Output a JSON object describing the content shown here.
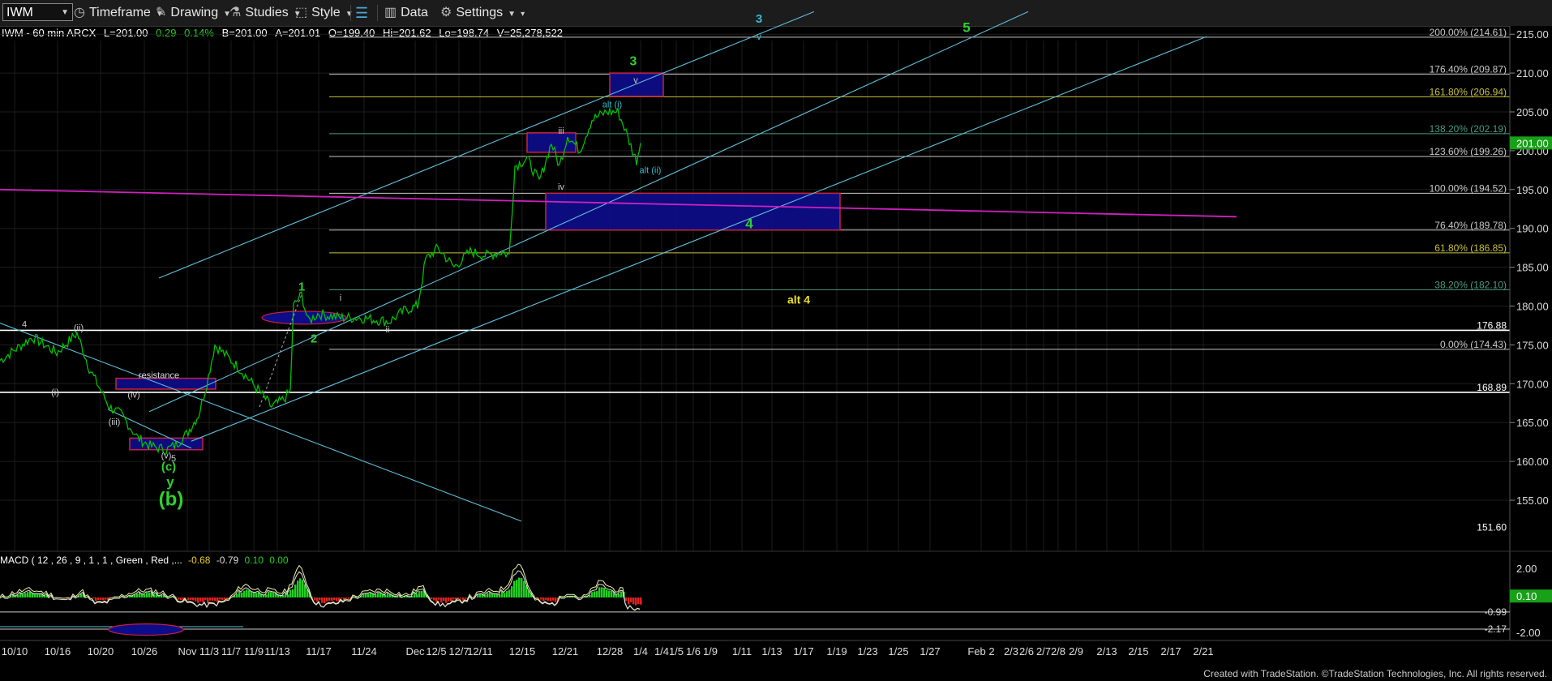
{
  "toolbar": {
    "symbol": "IWM",
    "timeframe": "Timeframe",
    "drawing": "Drawing",
    "studies": "Studies",
    "style": "Style",
    "data": "Data",
    "settings": "Settings"
  },
  "infobar": {
    "title": "IWM - 60 min  ARCX",
    "last": "L=201.00",
    "change": "0.29",
    "pct": "0.14%",
    "bid": "B=201.00",
    "ask": "A=201.01",
    "open": "O=199.40",
    "hi": "Hi=201.62",
    "lo": "Lo=198.74",
    "vol": "V=25,278,522"
  },
  "macd_label": {
    "title": "MACD ( 12 , 26 , 9 , 1 , 1 , Green , Red ,...",
    "v1": "-0.68",
    "v2": "-0.79",
    "v3": "0.10",
    "v4": "0.00"
  },
  "footer": "Created with TradeStation. ©TradeStation Technologies, Inc. All rights reserved.",
  "colors": {
    "price": "#00c000",
    "grid": "#1d1d1d",
    "channel": "#5fbfd8",
    "magenta": "#d020c0",
    "box_fill": "#0d0d8a",
    "box_edge": "#c8203c",
    "fib_green": "#4a9a80",
    "wave_green": "#2fd02f",
    "wave_cyan": "#3ab8d0",
    "alt_yellow": "#e8e020"
  },
  "chart_data": {
    "type": "line",
    "symbol": "IWM",
    "interval": "60 min",
    "price_axis": {
      "ylim": [
        151.6,
        218
      ],
      "ticks": [
        155,
        160,
        165,
        170,
        175,
        180,
        185,
        190,
        195,
        200,
        205,
        210,
        215
      ],
      "last_price": "201.00"
    },
    "date_ticks": [
      "10/10",
      "10/16",
      "10/20",
      "10/26",
      "Nov",
      "11/3",
      "11/7",
      "11/9",
      "11/13",
      "11/17",
      "11/24",
      "Dec",
      "12/5",
      "12/7",
      "12/11",
      "12/15",
      "12/21",
      "12/28",
      "1/4",
      "1/4",
      "1/5",
      "1/6",
      "1/9",
      "1/11",
      "1/13",
      "1/17",
      "1/19",
      "1/23",
      "1/25",
      "1/27",
      "Feb 2",
      "2/3",
      "2/6",
      "2/7",
      "2/8",
      "2/9",
      "2/13",
      "2/15",
      "2/17",
      "2/21"
    ],
    "price_series": [
      [
        0,
        173
      ],
      [
        40,
        176
      ],
      [
        70,
        174
      ],
      [
        95,
        176.5
      ],
      [
        110,
        172
      ],
      [
        135,
        167
      ],
      [
        150,
        166
      ],
      [
        170,
        163
      ],
      [
        185,
        162
      ],
      [
        205,
        161.5
      ],
      [
        215,
        162
      ],
      [
        230,
        163.5
      ],
      [
        245,
        166
      ],
      [
        255,
        170
      ],
      [
        265,
        175
      ],
      [
        275,
        174
      ],
      [
        295,
        172
      ],
      [
        320,
        169
      ],
      [
        335,
        167
      ],
      [
        350,
        168
      ],
      [
        358,
        169
      ],
      [
        362,
        180
      ],
      [
        372,
        181.5
      ],
      [
        380,
        178
      ],
      [
        392,
        179
      ],
      [
        420,
        178.5
      ],
      [
        445,
        178.5
      ],
      [
        480,
        178
      ],
      [
        500,
        179.5
      ],
      [
        515,
        180
      ],
      [
        525,
        186
      ],
      [
        540,
        187.5
      ],
      [
        560,
        185
      ],
      [
        580,
        187
      ],
      [
        600,
        186.5
      ],
      [
        620,
        187
      ],
      [
        628,
        186.5
      ],
      [
        635,
        198
      ],
      [
        650,
        199
      ],
      [
        665,
        196
      ],
      [
        680,
        201
      ],
      [
        690,
        198
      ],
      [
        700,
        202
      ],
      [
        715,
        200
      ],
      [
        730,
        204
      ],
      [
        748,
        205
      ],
      [
        762,
        205
      ],
      [
        770,
        203
      ],
      [
        780,
        200
      ],
      [
        785,
        198.74
      ],
      [
        790,
        201
      ]
    ],
    "horizontal_levels": [
      {
        "value": 214.61,
        "label": "200.00% (214.61)",
        "color": "#c8c8c8"
      },
      {
        "value": 209.87,
        "label": "176.40% (209.87)",
        "color": "#c8c8c8"
      },
      {
        "value": 206.94,
        "label": "161.80% (206.94)",
        "color": "#c8c040"
      },
      {
        "value": 202.19,
        "label": "138.20% (202.19)",
        "color": "#4a9a80"
      },
      {
        "value": 199.26,
        "label": "123.60% (199.26)",
        "color": "#c8c8c8"
      },
      {
        "value": 194.52,
        "label": "100.00% (194.52)",
        "color": "#c8c8c8"
      },
      {
        "value": 189.78,
        "label": "76.40% (189.78)",
        "color": "#c8c8c8"
      },
      {
        "value": 186.85,
        "label": "61.80% (186.85)",
        "color": "#c8c040"
      },
      {
        "value": 182.1,
        "label": "38.20% (182.10)",
        "color": "#4a9a80"
      },
      {
        "value": 176.88,
        "label": "176.88",
        "color": "#ffffff"
      },
      {
        "value": 174.43,
        "label": "0.00% (174.43)",
        "color": "#c8c8c8"
      },
      {
        "value": 168.89,
        "label": "168.89",
        "color": "#ffffff"
      },
      {
        "value": 151.6,
        "label": "151.60",
        "color": "#ffffff"
      }
    ],
    "wave_labels": [
      {
        "text": "3",
        "x": 936,
        "price": 216.5,
        "color": "#3ab8d0",
        "size": 15
      },
      {
        "text": "v",
        "x": 936,
        "price": 214.3,
        "color": "#3ab8d0",
        "size": 12
      },
      {
        "text": "5",
        "x": 1192,
        "price": 215.3,
        "color": "#2fd02f",
        "size": 17
      },
      {
        "text": "3",
        "x": 781,
        "price": 211.0,
        "color": "#2fd02f",
        "size": 16
      },
      {
        "text": "v",
        "x": 784,
        "price": 208.7,
        "color": "#cccccc",
        "size": 11
      },
      {
        "text": "alt (i)",
        "x": 755,
        "price": 205.6,
        "color": "#3ab8d0",
        "size": 11
      },
      {
        "text": "iii",
        "x": 692,
        "price": 202.2,
        "color": "#cccccc",
        "size": 11
      },
      {
        "text": "alt (ii)",
        "x": 802,
        "price": 197.1,
        "color": "#3ab8d0",
        "size": 11
      },
      {
        "text": "iv",
        "x": 692,
        "price": 195.0,
        "color": "#cccccc",
        "size": 11
      },
      {
        "text": "4",
        "x": 924,
        "price": 190.0,
        "color": "#2fd02f",
        "size": 17
      },
      {
        "text": "alt 4",
        "x": 985,
        "price": 180.3,
        "color": "#e8e020",
        "size": 14
      },
      {
        "text": "1",
        "x": 372,
        "price": 182.0,
        "color": "#2fd02f",
        "size": 15
      },
      {
        "text": "i",
        "x": 420,
        "price": 180.7,
        "color": "#cccccc",
        "size": 11
      },
      {
        "text": "2",
        "x": 387,
        "price": 175.3,
        "color": "#2fd02f",
        "size": 15
      },
      {
        "text": "ii",
        "x": 478,
        "price": 176.6,
        "color": "#cccccc",
        "size": 11
      },
      {
        "text": "4",
        "x": 30,
        "price": 177.3,
        "color": "#cccccc",
        "size": 11
      },
      {
        "text": "(ii)",
        "x": 97,
        "price": 176.8,
        "color": "#cccccc",
        "size": 11
      },
      {
        "text": "(i)",
        "x": 68,
        "price": 168.5,
        "color": "#cccccc",
        "size": 11
      },
      {
        "text": "resistance",
        "x": 196,
        "price": 170.7,
        "color": "#dddddd",
        "size": 11
      },
      {
        "text": "(iv)",
        "x": 165,
        "price": 168.2,
        "color": "#cccccc",
        "size": 11
      },
      {
        "text": "(iii)",
        "x": 141,
        "price": 164.7,
        "color": "#cccccc",
        "size": 11
      },
      {
        "text": "(v)",
        "x": 205,
        "price": 160.4,
        "color": "#cccccc",
        "size": 11
      },
      {
        "text": "5",
        "x": 214,
        "price": 160.0,
        "color": "#cccccc",
        "size": 11
      },
      {
        "text": "(c)",
        "x": 208,
        "price": 158.8,
        "color": "#2fd02f",
        "size": 15
      },
      {
        "text": "y",
        "x": 210,
        "price": 156.8,
        "color": "#2fd02f",
        "size": 17
      },
      {
        "text": "(b)",
        "x": 211,
        "price": 154.3,
        "color": "#2fd02f",
        "size": 24
      }
    ],
    "boxes": [
      {
        "x0": 752,
        "x1": 818,
        "p_top": 210.0,
        "p_bot": 207.0
      },
      {
        "x0": 650,
        "x1": 710,
        "p_top": 202.3,
        "p_bot": 199.8
      },
      {
        "x0": 673,
        "x1": 1036,
        "p_top": 194.52,
        "p_bot": 189.78
      },
      {
        "x0": 143,
        "x1": 266,
        "p_top": 170.7,
        "p_bot": 169.3
      },
      {
        "x0": 160,
        "x1": 250,
        "p_top": 163.0,
        "p_bot": 161.5
      }
    ],
    "channel_lines": [
      [
        [
          196,
          183.6
        ],
        [
          1004,
          217.9
        ]
      ],
      [
        [
          184,
          166.4
        ],
        [
          1268,
          217.9
        ]
      ],
      [
        [
          236,
          162.6
        ],
        [
          1488,
          214.7
        ]
      ],
      [
        [
          0,
          177.8
        ],
        [
          643,
          152.3
        ]
      ],
      [
        [
          133,
          166.7
        ],
        [
          236,
          161.7
        ]
      ]
    ],
    "magenta_line": [
      [
        0,
        195.0
      ],
      [
        1525,
        191.5
      ]
    ],
    "macd": {
      "range": [
        -2.7,
        2.8
      ],
      "ticks": [
        "2.00",
        "-2.00"
      ],
      "labels": [
        "-0.99",
        "0.10",
        "-2.17"
      ]
    }
  }
}
